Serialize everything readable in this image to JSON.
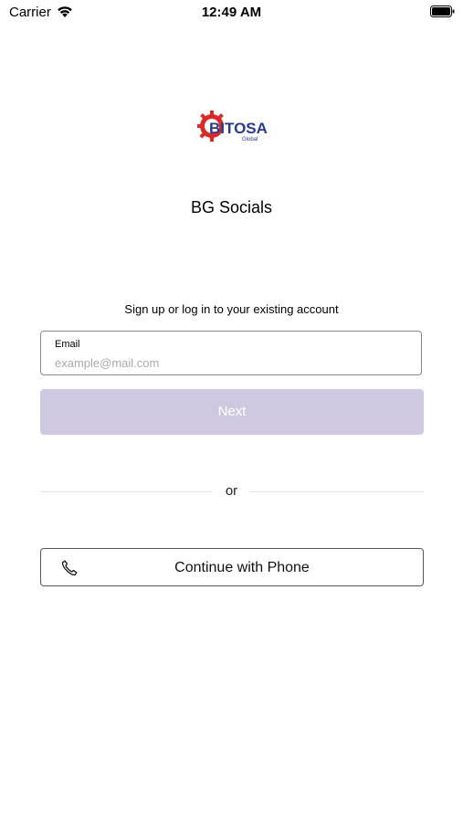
{
  "status_bar": {
    "carrier": "Carrier",
    "time": "12:49 AM",
    "wifi_icon": "wifi-icon",
    "battery_icon": "battery-icon"
  },
  "logo": {
    "text": "BITOSA",
    "subtext": "Global",
    "colors": {
      "gear": "#d92a2a",
      "text": "#2a3a8c"
    }
  },
  "app_name": "BG Socials",
  "subtitle": "Sign up or log in to your existing account",
  "email": {
    "label": "Email",
    "placeholder": "example@mail.com",
    "value": ""
  },
  "next_button": {
    "label": "Next",
    "color": "#cfc8e0"
  },
  "divider": {
    "text": "or"
  },
  "phone_button": {
    "label": "Continue with Phone",
    "icon": "phone-icon"
  }
}
